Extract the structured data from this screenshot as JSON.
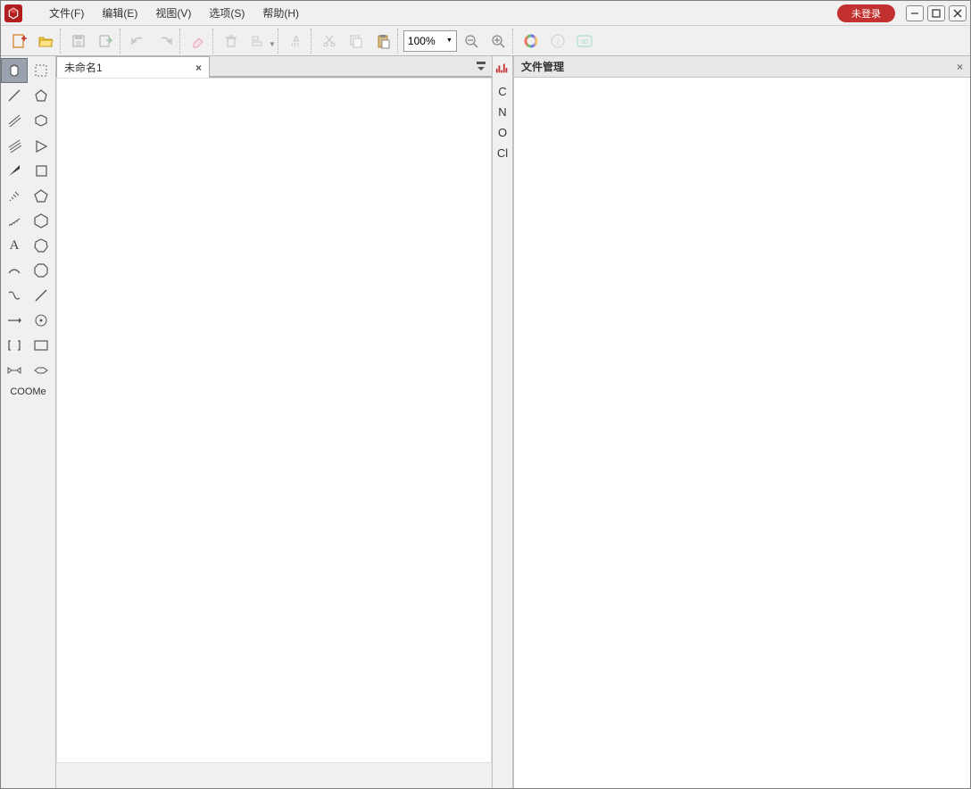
{
  "menu": {
    "file": "文件(F)",
    "edit": "编辑(E)",
    "view": "视图(V)",
    "options": "选项(S)",
    "help": "帮助(H)"
  },
  "header": {
    "login_label": "未登录"
  },
  "toolbar": {
    "zoom": "100%"
  },
  "document": {
    "tab_title": "未命名1"
  },
  "elements": {
    "items": [
      "C",
      "N",
      "O",
      "Cl"
    ]
  },
  "panel": {
    "title": "文件管理"
  },
  "toolbox": {
    "footer_label": "COOMe"
  }
}
